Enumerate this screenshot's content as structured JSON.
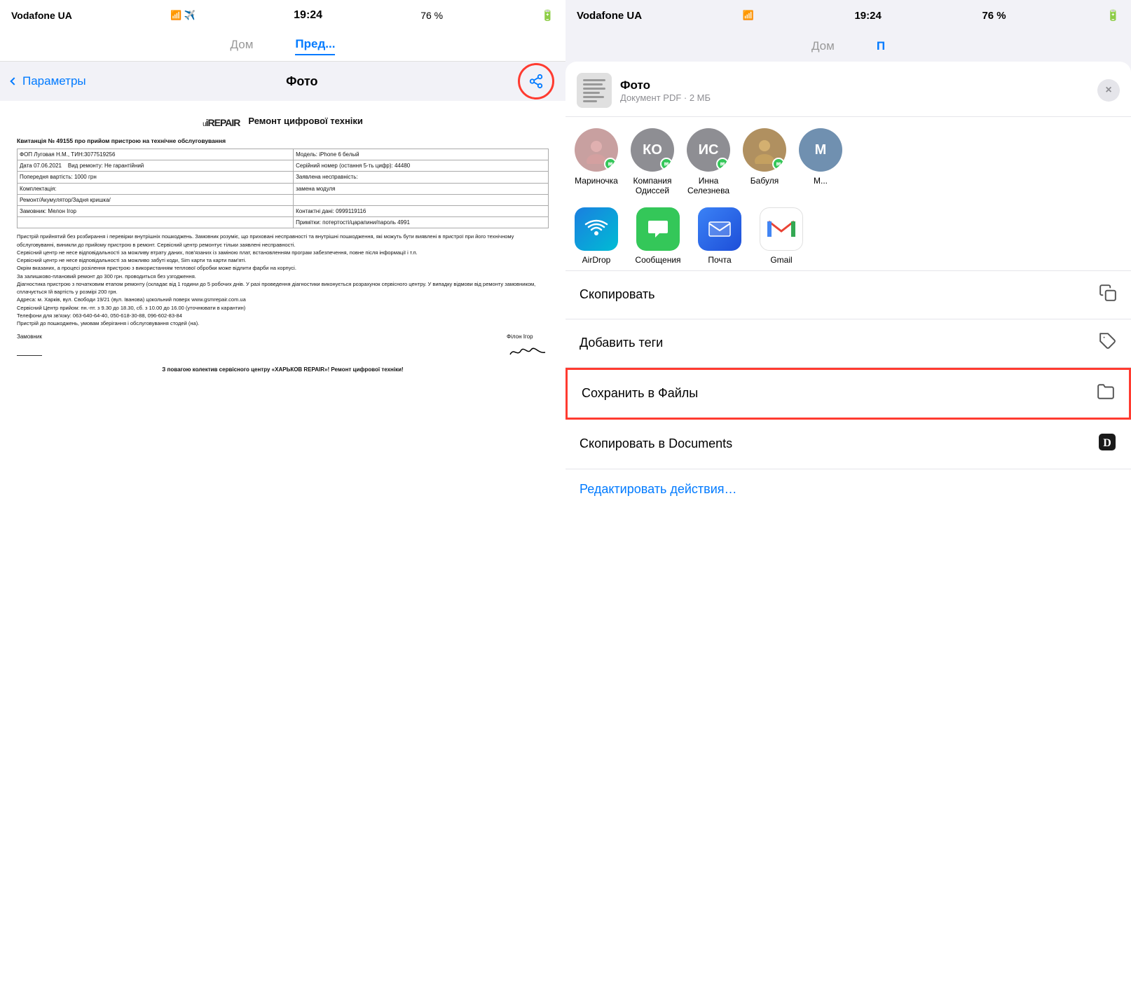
{
  "left": {
    "statusBar": {
      "carrier": "Vodafone UA",
      "wifi": "WiFi",
      "time": "19:24",
      "battery": "76 %"
    },
    "tabs": [
      {
        "label": "Дом",
        "active": false
      },
      {
        "label": "Пред...",
        "active": true
      }
    ],
    "navBack": "Параметры",
    "navTitle": "Фото",
    "shareBtn": "share",
    "doc": {
      "logo": "uiREPAIR",
      "title": "Ремонт цифрової техніки",
      "subtitle": "Квитанція № 49155 про прийом пристрою на технічне обслуговування",
      "row1": [
        {
          "label": "ФОП Луговая Н.М., ТИН:3077519256"
        },
        {
          "label": "Модель: iPhone 6 белый"
        }
      ],
      "row2": [
        {
          "label": "Дата 07.06.2021",
          "val": "Вид ремонту: Не гарантійний"
        },
        {
          "label": "Серійний номер (остання 5-ть цифр): 44480"
        }
      ],
      "fields": [
        {
          "key": "Попередня вартість:",
          "val": "1000 грн"
        },
        {
          "key": "Заявлена несправність:",
          "val": ""
        },
        {
          "key": "Комплектація:",
          "val": "замена модуля"
        },
        {
          "key": "",
          "val": ""
        },
        {
          "key": "Ремонт/Акумулятор/Задня кришка/",
          "val": ""
        },
        {
          "key": "",
          "val": ""
        },
        {
          "key": "Замовник:",
          "val": "Контактні дані:"
        },
        {
          "key": "Мелон Ігор",
          "val": "0999119116"
        },
        {
          "key": "",
          "val": "Примітки: потертості/царапини/пароль 4991"
        }
      ],
      "bodyText": "Пристрій прийнятий без розбирання і перевірки внутрішніх пошкоджень. Замовник розуміє, що приховані несправності та внутрішні пошкодження, які можуть бути виявлені в пристрої при його технічному обслуговуванні, виникли до прийому пристрою в ремонт. Сервісний центр ремонтує тільки заявлені несправності.\nСервісний центр не несе відповідальності за можливу втрату даних, пов'язаних із заміною плат, встановленням програм забезпечення, повне після інформації і т.п.\nСервісний центр не несе відповідальності за можливо забуті коди, Sim карти та карти пам'яті.\nОкрім вказаних, а процесі розілення пристрою з використанням теплової обробки може відлити фарби на корпусі.\nЗа залишково-плановий ремонт до 300 грн. проводиться без узгодження.\nДіагностика пристрою з початковим етапом ремонту (складає від 1 години до 5 робочих днів. У разі проведення діагностики виконується розрахунок сервісного центру. У випадку відмови від ремонту замовником, сплачується їй вартість у розмірі 200 грн.\nАдреса: м. Харків, вул. Свободи 19/21 (вул. Іванова) цокольний поверх www.gsmrepair.com.ua\nСервісний Центр прийом: пн.-пт. з 9.30 до 18.30, сб. з 10.00 до 16.00 (уточнювати в карантин)\nТелефони для зв'язку: 063-640-64-40, 050-618-30-88, 096-602-83-84\nПристрій до пошкоджень, умовам зберігання і обслуговування стодей (на).",
      "sigLabel": "Замовник",
      "sigName": "Філон Ігор",
      "footer": "З повагою колектив сервісного центру «ХАРЬКОВ REPAIR»! Ремонт цифрової техніки!"
    }
  },
  "right": {
    "statusBar": {
      "carrier": "Vodafone UA",
      "wifi": "WiFi",
      "time": "19:24",
      "battery": "76 %"
    },
    "tabs": [
      {
        "label": "Дом",
        "active": false
      },
      {
        "label": "П",
        "active": true
      }
    ],
    "shareSheet": {
      "fileName": "Фото",
      "fileDesc": "Документ PDF · 2 МБ",
      "closeBtn": "×",
      "contacts": [
        {
          "name": "Мариночка",
          "initials": "",
          "color": "#b0b0b0",
          "hasPhoto": true,
          "bg": "#c8a0a0"
        },
        {
          "name": "Компания Одиссей",
          "initials": "КО",
          "color": "#8e8e93",
          "bg": "#8e8e93"
        },
        {
          "name": "Инна Селезнева",
          "initials": "ИС",
          "color": "#8e8e93",
          "bg": "#8e8e93"
        },
        {
          "name": "Бабуля",
          "initials": "",
          "hasPhoto": true,
          "bg": "#b09060"
        },
        {
          "name": "М...",
          "initials": "М",
          "bg": "#7090b0"
        }
      ],
      "apps": [
        {
          "name": "AirDrop",
          "type": "airdrop"
        },
        {
          "name": "Сообщения",
          "type": "messages"
        },
        {
          "name": "Почта",
          "type": "mail"
        },
        {
          "name": "Gmail",
          "type": "gmail"
        }
      ],
      "actions": [
        {
          "label": "Скопировать",
          "icon": "copy",
          "highlighted": false
        },
        {
          "label": "Добавить теги",
          "icon": "tag",
          "highlighted": false
        },
        {
          "label": "Сохранить в Файлы",
          "icon": "folder",
          "highlighted": true
        },
        {
          "label": "Скопировать в Documents",
          "icon": "documents",
          "highlighted": false
        }
      ],
      "editActions": "Редактировать действия…"
    }
  }
}
